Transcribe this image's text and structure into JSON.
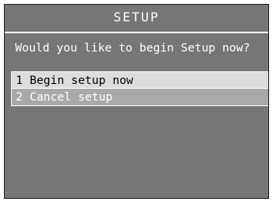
{
  "screen": {
    "title": "SETUP",
    "prompt": "Would you like to begin Setup now?",
    "options": [
      {
        "label": "1 Begin setup now",
        "selected": true
      },
      {
        "label": "2 Cancel setup",
        "selected": false
      }
    ]
  },
  "colors": {
    "background": "#767676",
    "selected_bg": "#dcdcdc",
    "unselected_bg": "#a9a9a9",
    "text": "#ffffff"
  }
}
